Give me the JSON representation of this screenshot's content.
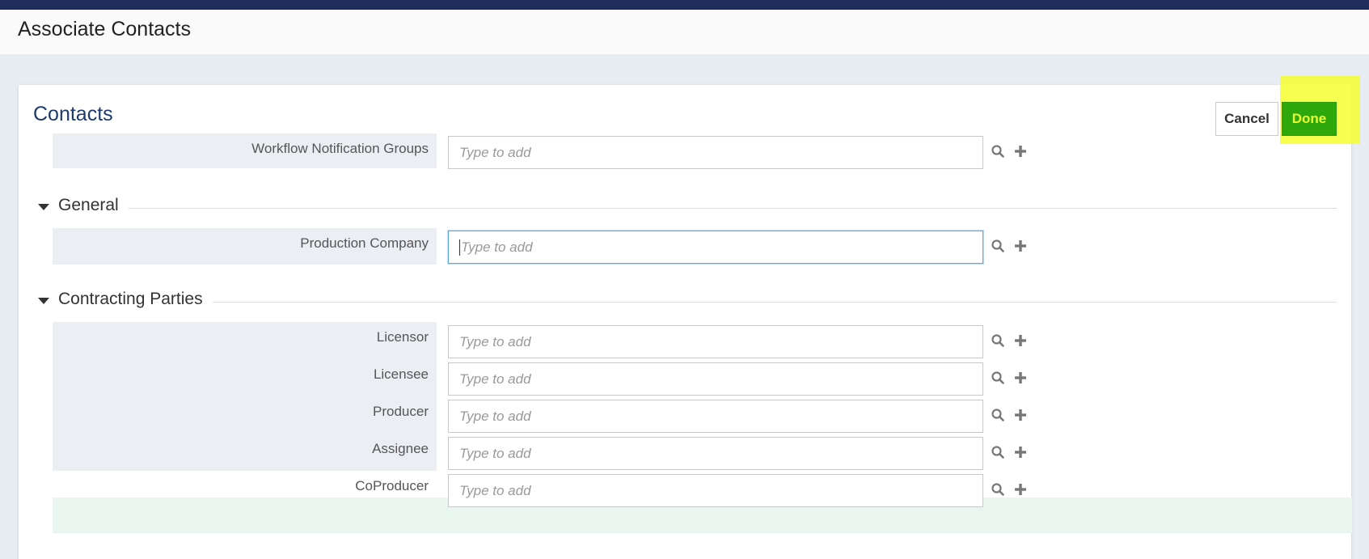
{
  "header": {
    "title": "Associate Contacts"
  },
  "card": {
    "title": "Contacts",
    "cancel_label": "Cancel",
    "done_label": "Done"
  },
  "workflow": {
    "label": "Workflow Notification Groups",
    "placeholder": "Type to add"
  },
  "sections": {
    "general": {
      "title": "General",
      "fields": [
        {
          "label": "Production Company",
          "placeholder": "Type to add"
        }
      ]
    },
    "contracting": {
      "title": "Contracting Parties",
      "fields": [
        {
          "label": "Licensor",
          "placeholder": "Type to add"
        },
        {
          "label": "Licensee",
          "placeholder": "Type to add"
        },
        {
          "label": "Producer",
          "placeholder": "Type to add"
        },
        {
          "label": "Assignee",
          "placeholder": "Type to add"
        },
        {
          "label": "CoProducer",
          "placeholder": "Type to add"
        }
      ]
    }
  },
  "icons": {
    "search": "search-icon",
    "add": "plus-icon"
  },
  "colors": {
    "topbar": "#1f2d5c",
    "title": "#1f3a6e",
    "done_bg": "#2fa80d",
    "done_text": "#e9ff34",
    "highlight": "#f4ff30"
  }
}
